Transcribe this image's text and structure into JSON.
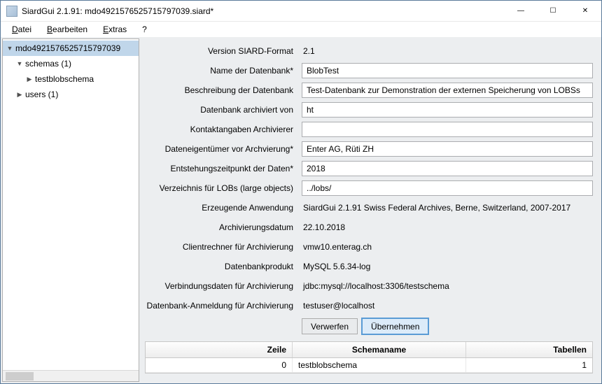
{
  "window": {
    "title": "SiardGui 2.1.91: mdo4921576525715797039.siard*",
    "min_label": "—",
    "max_label": "☐",
    "close_label": "✕"
  },
  "menu": {
    "items": [
      "Datei",
      "Bearbeiten",
      "Extras",
      "?"
    ]
  },
  "tree": {
    "root": "mdo4921576525715797039",
    "nodes": [
      {
        "label": "schemas (1)",
        "expanded": true,
        "depth": 1
      },
      {
        "label": "testblobschema",
        "expanded": false,
        "depth": 2,
        "has_children": true
      },
      {
        "label": "users (1)",
        "expanded": false,
        "depth": 1,
        "has_children": true
      }
    ]
  },
  "form": {
    "rows": [
      {
        "label": "Version SIARD-Format",
        "value": "2.1",
        "type": "text"
      },
      {
        "label": "Name der Datenbank*",
        "value": "BlobTest",
        "type": "input"
      },
      {
        "label": "Beschreibung der Datenbank",
        "value": "Test-Datenbank zur Demonstration der externen Speicherung von LOBSs",
        "type": "input"
      },
      {
        "label": "Datenbank archiviert von",
        "value": "ht",
        "type": "input"
      },
      {
        "label": "Kontaktangaben Archivierer",
        "value": "",
        "type": "input"
      },
      {
        "label": "Dateneigentümer vor Archvierung*",
        "value": "Enter AG, Rüti ZH",
        "type": "input"
      },
      {
        "label": "Entstehungszeitpunkt der Daten*",
        "value": "2018",
        "type": "input"
      },
      {
        "label": "Verzeichnis für LOBs (large objects)",
        "value": "../lobs/",
        "type": "input"
      },
      {
        "label": "Erzeugende Anwendung",
        "value": "SiardGui 2.1.91 Swiss Federal Archives, Berne, Switzerland, 2007-2017",
        "type": "text"
      },
      {
        "label": "Archivierungsdatum",
        "value": "22.10.2018",
        "type": "text"
      },
      {
        "label": "Clientrechner für Archivierung",
        "value": "vmw10.enterag.ch",
        "type": "text"
      },
      {
        "label": "Datenbankprodukt",
        "value": "MySQL 5.6.34-log",
        "type": "text"
      },
      {
        "label": "Verbindungsdaten für Archivierung",
        "value": "jdbc:mysql://localhost:3306/testschema",
        "type": "text"
      },
      {
        "label": "Datenbank-Anmeldung für Archivierung",
        "value": "testuser@localhost",
        "type": "text"
      }
    ],
    "buttons": {
      "discard": "Verwerfen",
      "apply": "Übernehmen"
    }
  },
  "table": {
    "headers": {
      "zeile": "Zeile",
      "schema": "Schemaname",
      "tab": "Tabellen"
    },
    "rows": [
      {
        "zeile": "0",
        "schema": "testblobschema",
        "tab": "1"
      }
    ]
  }
}
